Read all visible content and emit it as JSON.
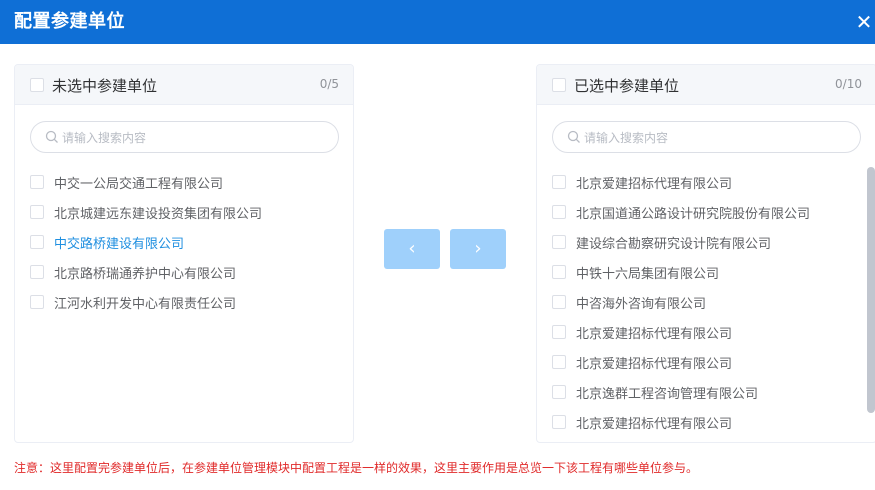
{
  "header": {
    "title": "配置参建单位",
    "close_icon": "✕"
  },
  "left_panel": {
    "title": "未选中参建单位",
    "count": "0/5",
    "search_placeholder": "请输入搜索内容",
    "items": [
      {
        "label": "中交一公局交通工程有限公司"
      },
      {
        "label": "北京城建远东建设投资集团有限公司"
      },
      {
        "label": "中交路桥建设有限公司"
      },
      {
        "label": "北京路桥瑞通养护中心有限公司"
      },
      {
        "label": "江河水利开发中心有限责任公司"
      }
    ]
  },
  "right_panel": {
    "title": "已选中参建单位",
    "count": "0/10",
    "search_placeholder": "请输入搜索内容",
    "items": [
      {
        "label": "北京爱建招标代理有限公司"
      },
      {
        "label": "北京国道通公路设计研究院股份有限公司"
      },
      {
        "label": "建设综合勘察研究设计院有限公司"
      },
      {
        "label": "中铁十六局集团有限公司"
      },
      {
        "label": "中咨海外咨询有限公司"
      },
      {
        "label": "北京爱建招标代理有限公司"
      },
      {
        "label": "北京爱建招标代理有限公司"
      },
      {
        "label": "北京逸群工程咨询管理有限公司"
      },
      {
        "label": "北京爱建招标代理有限公司"
      }
    ]
  },
  "transfer": {
    "to_left": "‹",
    "to_right": "›"
  },
  "note": "注意：这里配置完参建单位后，在参建单位管理模块中配置工程是一样的效果，这里主要作用是总览一下该工程有哪些单位参与。",
  "colors": {
    "header": "#0f6fd6",
    "accent": "#1f8fe0",
    "button": "#9fd0fb",
    "warning": "#e02a2a"
  }
}
